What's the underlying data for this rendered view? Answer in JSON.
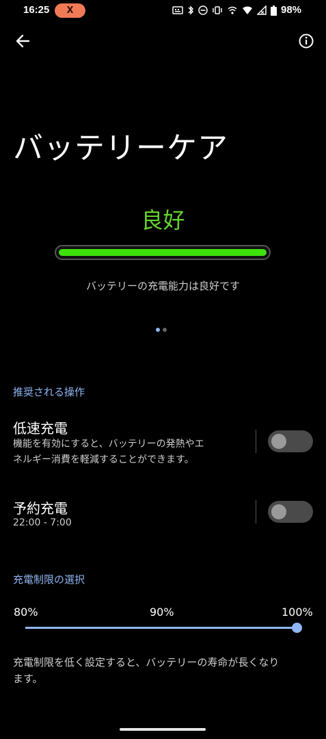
{
  "status_bar": {
    "time": "16:25",
    "notification_badge": "X",
    "battery_percent": "98%",
    "icons": [
      "keyboard-icon",
      "bluetooth-icon",
      "dnd-icon",
      "vibrate-icon",
      "hotspot-icon",
      "wifi-icon",
      "signal-icon",
      "battery-icon"
    ]
  },
  "header": {
    "title": "バッテリーケア"
  },
  "health": {
    "status": "良好",
    "level": 1.0,
    "color": "#3fe10d",
    "description": "バッテリーの充電能力は良好です"
  },
  "pager": {
    "pages": 2,
    "active": 0
  },
  "recommended": {
    "header": "推奨される操作",
    "slow_charge": {
      "title": "低速充電",
      "description_line1": "機能を有効にすると、バッテリーの発熱やエ",
      "description_line2": "ネルギー消費を軽減することができます。",
      "enabled": false
    },
    "scheduled_charge": {
      "title": "予約充電",
      "subtitle": "22:00 - 7:00",
      "enabled": false
    }
  },
  "charge_limit": {
    "header": "充電制限の選択",
    "labels": [
      "80%",
      "90%",
      "100%"
    ],
    "selected": "100%",
    "description_line1": "充電制限を低く設定すると、バッテリーの寿命が長くなり",
    "description_line2": "ます。"
  },
  "colors": {
    "accent": "#8fb6f2",
    "good": "#66d42f"
  }
}
